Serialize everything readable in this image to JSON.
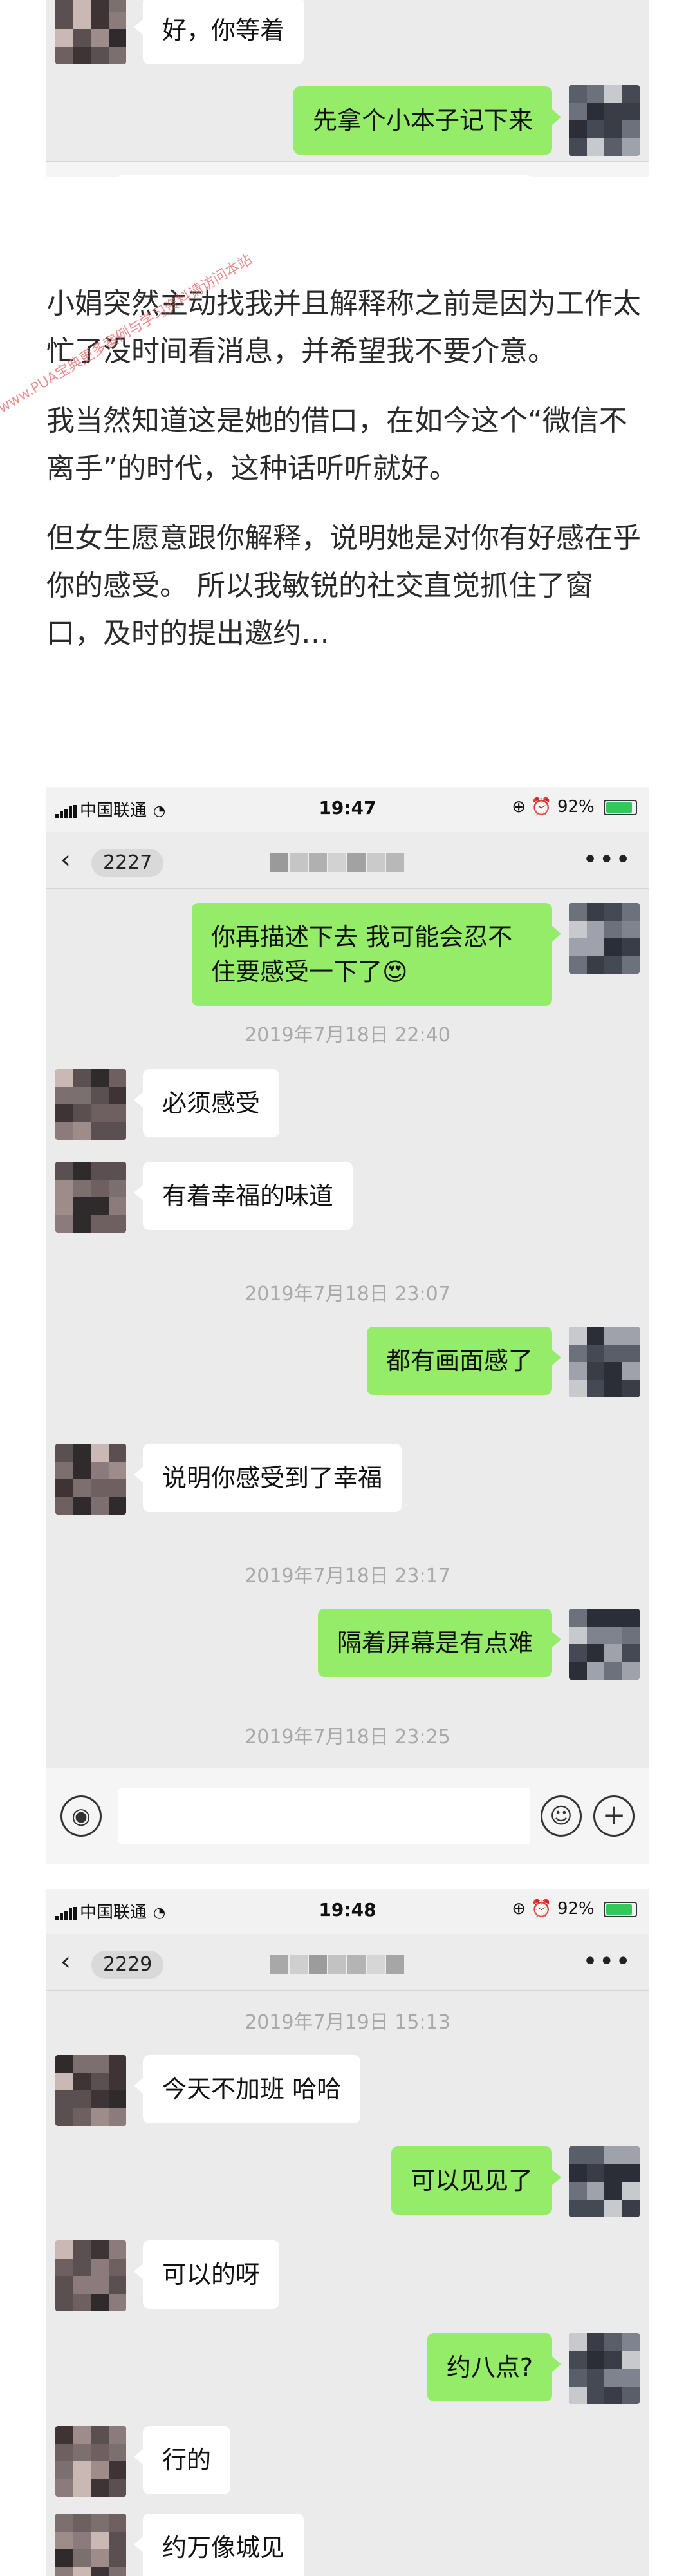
{
  "shot1": {
    "messages": [
      {
        "side": "left",
        "text": "好，你等着"
      },
      {
        "side": "right",
        "text": "先拿个小本子记下来"
      }
    ]
  },
  "article": {
    "paragraphs": [
      "小娟突然主动找我并且解释称之前是因为工作太忙了没时间看消息，并希望我不要介意。",
      "我当然知道这是她的借口，在如今这个“微信不离手”的时代，这种话听听就好。",
      "但女生愿意跟你解释，说明她是对你有好感在乎你的感受。 所以我敏锐的社交直觉抓住了窗口，及时的提出邀约…"
    ],
    "watermark": "www.PUA宝典更多案例与学习资料请访问本站"
  },
  "shot2": {
    "status_bar": {
      "carrier": "中国联通",
      "time": "19:47",
      "battery": "92%"
    },
    "nav": {
      "back_label": "2227"
    },
    "messages": [
      {
        "side": "right",
        "text": "你再描述下去 我可能会忍不住要感受一下了😍"
      },
      {
        "type": "time",
        "text": "2019年7月18日 22:40"
      },
      {
        "side": "left",
        "text": "必须感受"
      },
      {
        "side": "left",
        "text": "有着幸福的味道"
      },
      {
        "type": "time",
        "text": "2019年7月18日 23:07"
      },
      {
        "side": "right",
        "text": "都有画面感了"
      },
      {
        "side": "left",
        "text": "说明你感受到了幸福"
      },
      {
        "type": "time",
        "text": "2019年7月18日 23:17"
      },
      {
        "side": "right",
        "text": "隔着屏幕是有点难"
      },
      {
        "type": "time",
        "text": "2019年7月18日 23:25"
      }
    ]
  },
  "shot3": {
    "status_bar": {
      "carrier": "中国联通",
      "time": "19:48",
      "battery": "92%"
    },
    "nav": {
      "back_label": "2229"
    },
    "messages": [
      {
        "type": "time",
        "text": "2019年7月19日 15:13"
      },
      {
        "side": "left",
        "text": "今天不加班 哈哈"
      },
      {
        "side": "right",
        "text": "可以见见了"
      },
      {
        "side": "left",
        "text": "可以的呀"
      },
      {
        "side": "right",
        "text": "约八点?"
      },
      {
        "side": "left",
        "text": "行的"
      },
      {
        "side": "left",
        "text": "约万像城见"
      }
    ]
  },
  "icons": {
    "voice": "voice-icon",
    "emoji": "emoji-icon",
    "plus": "plus-icon",
    "back": "chevron-left-icon",
    "more": "more-icon",
    "signal": "signal-icon",
    "wifi": "wifi-icon",
    "battery": "battery-icon"
  },
  "colors": {
    "chat_bg": "#ebebeb",
    "bubble_mine": "#95ec69",
    "bubble_theirs": "#ffffff",
    "timestamp": "#a9a9a9",
    "watermark": "#e06060"
  }
}
